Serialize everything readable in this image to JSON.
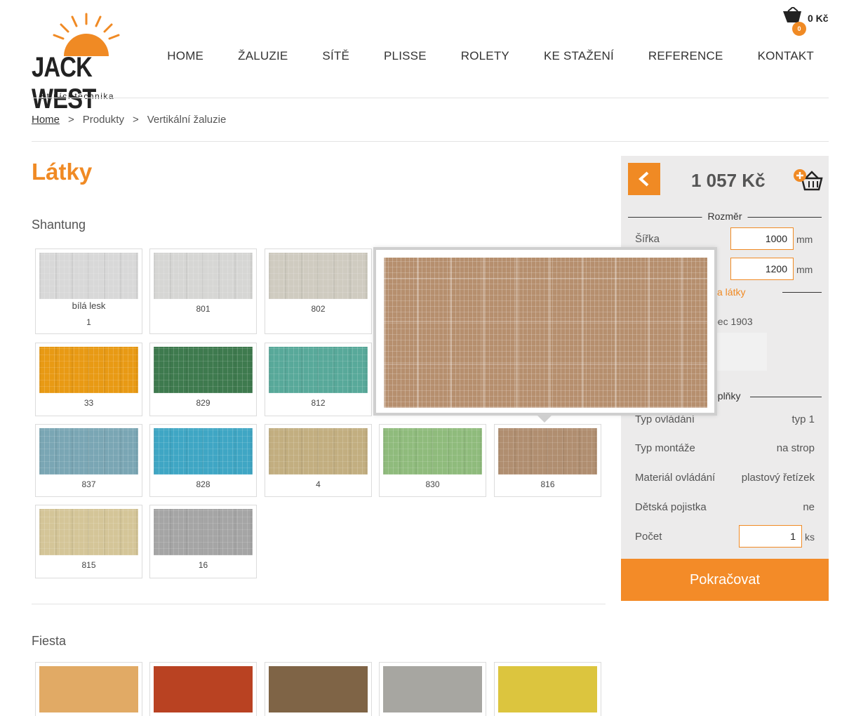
{
  "brand": {
    "logo_title": "JACK WEST",
    "logo_subtitle": "Stínící technika",
    "sun_color": "#f08a24"
  },
  "cart": {
    "count": "0",
    "total": "0 Kč"
  },
  "nav": [
    "HOME",
    "ŽALUZIE",
    "SÍTĚ",
    "PLISSE",
    "ROLETY",
    "KE STAŽENÍ",
    "REFERENCE",
    "KONTAKT"
  ],
  "breadcrumb": {
    "home": "Home",
    "sep": ">",
    "level2": "Produkty",
    "level3": "Vertikální žaluzie"
  },
  "page_title": "Látky",
  "sections": {
    "shantung": "Shantung",
    "fiesta": "Fiesta"
  },
  "shantung_swatches": [
    {
      "name": "bílá lesk",
      "code": "1",
      "color": "#d8d8d8"
    },
    {
      "code": "801",
      "color": "#d6d6d4"
    },
    {
      "code": "802",
      "color": "#cfcbc0"
    },
    {
      "code": "33",
      "color": "#e89a14"
    },
    {
      "code": "829",
      "color": "#3e7a4e"
    },
    {
      "code": "812",
      "color": "#58a99a"
    },
    {
      "code": "837",
      "color": "#7aa6b4"
    },
    {
      "code": "828",
      "color": "#3fa6c4"
    },
    {
      "code": "4",
      "color": "#c2ae80"
    },
    {
      "code": "830",
      "color": "#8fbb7c"
    },
    {
      "code": "816",
      "color": "#b08e70"
    },
    {
      "code": "815",
      "color": "#d4c598"
    },
    {
      "code": "16",
      "color": "#a5a5a5"
    }
  ],
  "fiesta_swatches": [
    {
      "color": "#e1aa65"
    },
    {
      "color": "#b94222"
    },
    {
      "color": "#7f6446"
    },
    {
      "color": "#a7a6a1"
    },
    {
      "color": "#dcc53e"
    }
  ],
  "popup_color": "#b68f6e",
  "sidebar": {
    "price": "1 057 Kč",
    "rozmer": "Rozměr",
    "sirka_label": "Šířka",
    "sirka_value": "1000",
    "vyska_value": "1200",
    "unit_mm": "mm",
    "fabric_label_partial": "va látky",
    "fabric_name_partial": "pec 1903",
    "doplnky_partial": "oplňky",
    "rows": [
      {
        "label": "Typ ovládání",
        "value": "typ 1"
      },
      {
        "label": "Typ montáže",
        "value": "na strop"
      },
      {
        "label": "Materiál ovládání",
        "value": "plastový řetízek"
      },
      {
        "label": "Dětská pojistka",
        "value": "ne"
      }
    ],
    "pocet_label": "Počet",
    "pocet_value": "1",
    "unit_ks": "ks",
    "continue": "Pokračovat"
  }
}
